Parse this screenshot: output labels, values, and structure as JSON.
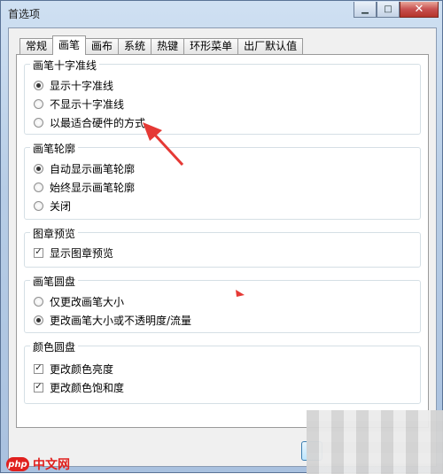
{
  "window": {
    "title": "首选项"
  },
  "tabs": [
    {
      "label": "常规"
    },
    {
      "label": "画笔",
      "active": true
    },
    {
      "label": "画布"
    },
    {
      "label": "系统"
    },
    {
      "label": "热键"
    },
    {
      "label": "环形菜单"
    },
    {
      "label": "出厂默认值"
    }
  ],
  "groups": {
    "crosshair": {
      "title": "画笔十字准线",
      "options": [
        {
          "label": "显示十字准线",
          "checked": true
        },
        {
          "label": "不显示十字准线",
          "checked": false
        },
        {
          "label": "以最适合硬件的方式",
          "checked": false
        }
      ]
    },
    "outline": {
      "title": "画笔轮廓",
      "options": [
        {
          "label": "自动显示画笔轮廓",
          "checked": true
        },
        {
          "label": "始终显示画笔轮廓",
          "checked": false
        },
        {
          "label": "关闭",
          "checked": false
        }
      ]
    },
    "stamp": {
      "title": "图章预览",
      "options": [
        {
          "label": "显示图章预览",
          "checked": true
        }
      ]
    },
    "puck": {
      "title": "画笔圆盘",
      "options": [
        {
          "label": "仅更改画笔大小",
          "checked": false
        },
        {
          "label": "更改画笔大小或不透明度/流量",
          "checked": true
        }
      ]
    },
    "colorpuck": {
      "title": "颜色圆盘",
      "options": [
        {
          "label": "更改颜色亮度",
          "checked": true
        },
        {
          "label": "更改颜色饱和度",
          "checked": true
        }
      ]
    }
  },
  "watermark": {
    "logo": "php",
    "text": "中文网"
  },
  "colors": {
    "annotation_arrow": "#e53935"
  }
}
